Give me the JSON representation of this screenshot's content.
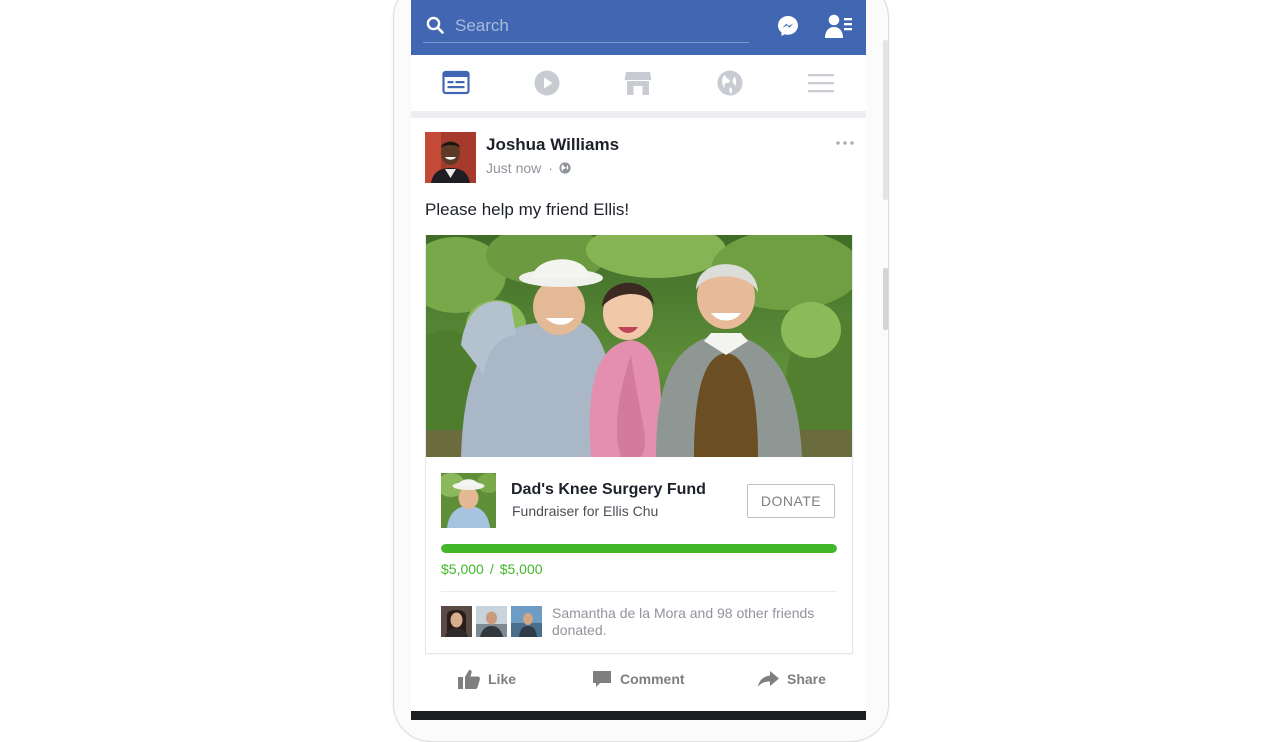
{
  "topbar": {
    "search_placeholder": "Search",
    "icons": [
      "search-icon",
      "messenger-icon",
      "friend-requests-icon"
    ],
    "color": "#4267b2"
  },
  "nav": {
    "tabs": [
      {
        "name": "news-feed",
        "icon": "news-feed-icon",
        "active": true
      },
      {
        "name": "watch",
        "icon": "play-icon",
        "active": false
      },
      {
        "name": "marketplace",
        "icon": "marketplace-icon",
        "active": false
      },
      {
        "name": "notifications",
        "icon": "globe-icon",
        "active": false
      },
      {
        "name": "menu",
        "icon": "hamburger-icon",
        "active": false
      }
    ]
  },
  "post": {
    "author": "Joshua Williams",
    "time": "Just now",
    "separator": "·",
    "audience_icon": "globe-icon",
    "text": "Please help my friend Ellis!",
    "fundraiser": {
      "title": "Dad's Knee Surgery Fund",
      "subtitle": "Fundraiser for Ellis Chu",
      "donate_label": "DONATE",
      "raised": "$5,000",
      "amount_separator": "/",
      "goal": "$5,000",
      "progress_fraction": 1.0,
      "progress_color": "#42b72a",
      "donors_text": "Samantha de la Mora and 98 other friends donated."
    },
    "actions": {
      "like": "Like",
      "comment": "Comment",
      "share": "Share"
    }
  }
}
